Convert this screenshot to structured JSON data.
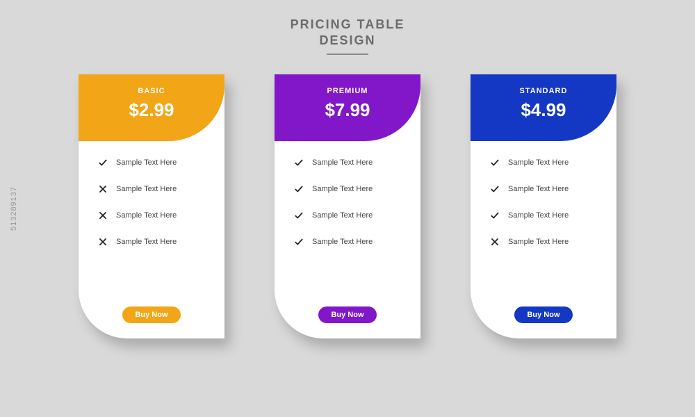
{
  "title_line1": "PRICING TABLE",
  "title_line2": "DESIGN",
  "watermark": "513289137",
  "feature_text": "Sample Text Here",
  "plans": [
    {
      "name": "BASIC",
      "price": "$2.99",
      "color": "#f2a516",
      "cta": "Buy Now",
      "features": [
        {
          "included": true
        },
        {
          "included": false
        },
        {
          "included": false
        },
        {
          "included": false
        }
      ]
    },
    {
      "name": "PREMIUM",
      "price": "$7.99",
      "color": "#8216c9",
      "cta": "Buy Now",
      "features": [
        {
          "included": true
        },
        {
          "included": true
        },
        {
          "included": true
        },
        {
          "included": true
        }
      ]
    },
    {
      "name": "STANDARD",
      "price": "$4.99",
      "color": "#1438c4",
      "cta": "Buy Now",
      "features": [
        {
          "included": true
        },
        {
          "included": true
        },
        {
          "included": true
        },
        {
          "included": false
        }
      ]
    }
  ]
}
